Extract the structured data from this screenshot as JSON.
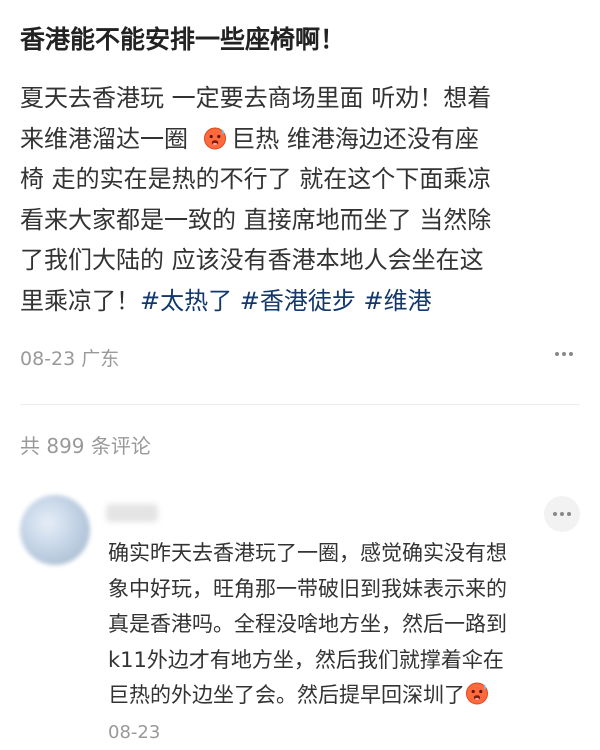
{
  "post": {
    "title": "香港能不能安排一些座椅啊！",
    "body_lines": [
      "夏天去香港玩  一定要去商场里面  听劝！想着",
      "来维港溜达一圈",
      "巨热  维港海边还没有座",
      "椅  走的实在是热的不行了  就在这个下面乘凉",
      "看来大家都是一致的  直接席地而坐了  当然除",
      "了我们大陆的  应该没有香港本地人会坐在这",
      "里乘凉了！"
    ],
    "hashtags": [
      "#太热了",
      "#香港徒步",
      "#维港"
    ],
    "meta": "08-23 广东",
    "emoji": "hot-face-icon"
  },
  "comments_section": {
    "count_text": "共 899 条评论"
  },
  "comment": {
    "text_lines": [
      "确实昨天去香港玩了一圈，感觉确实没有想",
      "象中好玩，旺角那一带破旧到我妹表示来的",
      "真是香港吗。全程没啥地方坐，然后一路到",
      "k11外边才有地方坐，然后我们就撑着伞在",
      "巨热的外边坐了会。然后提早回深圳了"
    ],
    "date": "08-23",
    "emoji": "hot-face-icon"
  },
  "colors": {
    "hashtag": "#13386c",
    "meta": "#999999",
    "text": "#333333"
  }
}
